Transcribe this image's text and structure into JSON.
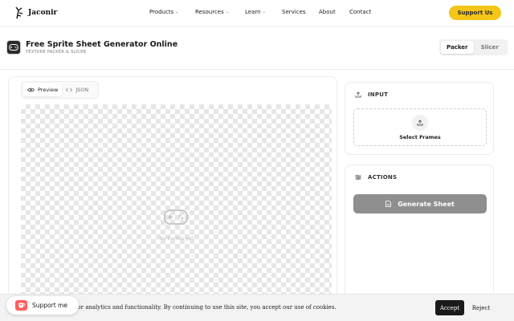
{
  "nav": {
    "brand": "Jaconir",
    "items": [
      {
        "label": "Products",
        "dropdown": true
      },
      {
        "label": "Resources",
        "dropdown": true
      },
      {
        "label": "Learn",
        "dropdown": true
      },
      {
        "label": "Services",
        "dropdown": false
      },
      {
        "label": "About",
        "dropdown": false
      },
      {
        "label": "Contact",
        "dropdown": false
      }
    ],
    "cta": "Support Us",
    "cta_color": "#f5c518"
  },
  "header": {
    "title": "Free Sprite Sheet Generator Online",
    "subtitle": "TEXTURE PACKER & SLICER",
    "modes": [
      "Packer",
      "Slicer"
    ],
    "active_mode": "Packer"
  },
  "preview": {
    "tabs": [
      {
        "label": "Preview",
        "icon": "eye-icon",
        "active": true
      },
      {
        "label": "JSON",
        "icon": "code-icon",
        "active": false
      }
    ],
    "empty_icon": "gamepad-icon",
    "empty_text": "No frames yet"
  },
  "input": {
    "heading": "INPUT",
    "select_label": "Select Frames"
  },
  "actions": {
    "heading": "ACTIONS",
    "generate_label": "Generate Sheet",
    "generate_color": "#8f8f8f"
  },
  "cookie": {
    "text": "s for analytics and functionality. By continuing to use this site, you accept our use of cookies.",
    "accept": "Accept",
    "reject": "Reject"
  },
  "support_widget": {
    "label": "Support me",
    "color": "#ff5f5f"
  }
}
